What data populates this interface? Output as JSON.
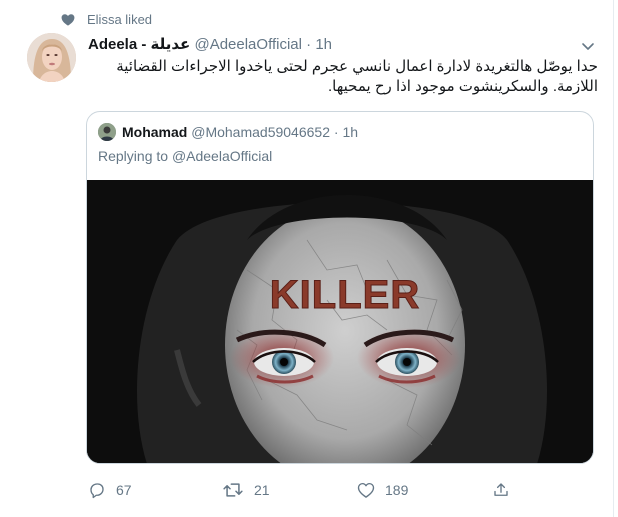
{
  "social_context": {
    "text": "Elissa liked"
  },
  "tweet": {
    "display_name": "Adeela - عديلة",
    "handle": "@AdeelaOfficial",
    "dot": "·",
    "time": "1h",
    "text": "حدا يوصّل هالتغريدة لادارة اعمال نانسي عجرم لحتى ياخدوا الاجراءات القضائية اللازمة. والسكرينشوت موجود اذا رح يمحيها."
  },
  "quoted_tweet": {
    "display_name": "Mohamad",
    "handle": "@Mohamad59046652",
    "dot": "·",
    "time": "1h",
    "replying_prefix": "Replying to",
    "replying_to": "@AdeelaOfficial",
    "image_text": "KILLER"
  },
  "actions": {
    "reply_count": "67",
    "retweet_count": "21",
    "like_count": "189"
  },
  "colors": {
    "secondary_text": "#657786",
    "border": "#ccd6dd",
    "primary_text": "#14171a"
  },
  "icons": [
    "heart-icon",
    "chevron-down-icon",
    "reply-icon",
    "retweet-icon",
    "like-icon",
    "share-icon"
  ]
}
